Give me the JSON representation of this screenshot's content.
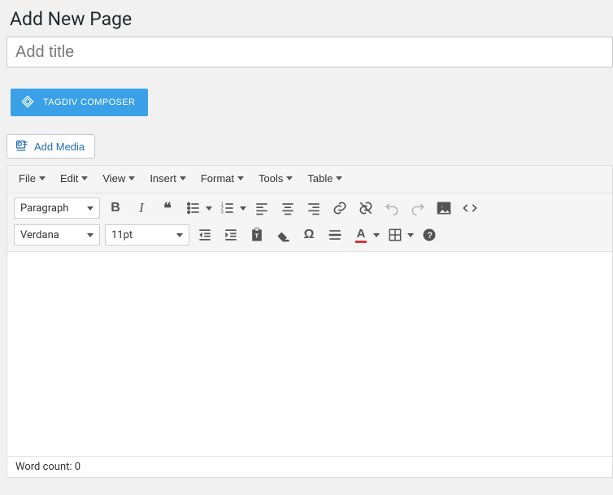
{
  "page": {
    "heading": "Add New Page"
  },
  "title_field": {
    "value": "",
    "placeholder": "Add title"
  },
  "composer": {
    "label": "TAGDIV COMPOSER"
  },
  "add_media": {
    "label": "Add Media"
  },
  "menubar": {
    "file": "File",
    "edit": "Edit",
    "view": "View",
    "insert": "Insert",
    "format": "Format",
    "tools": "Tools",
    "table": "Table"
  },
  "toolbar1": {
    "format_select": "Paragraph",
    "bold": "B",
    "italic": "I",
    "blockquote": "❝",
    "omega": "Ω"
  },
  "toolbar2": {
    "font_select": "Verdana",
    "size_select": "11pt",
    "text_color_letter": "A",
    "help": "?"
  },
  "status": {
    "word_count_label": "Word count:",
    "word_count": "0"
  }
}
